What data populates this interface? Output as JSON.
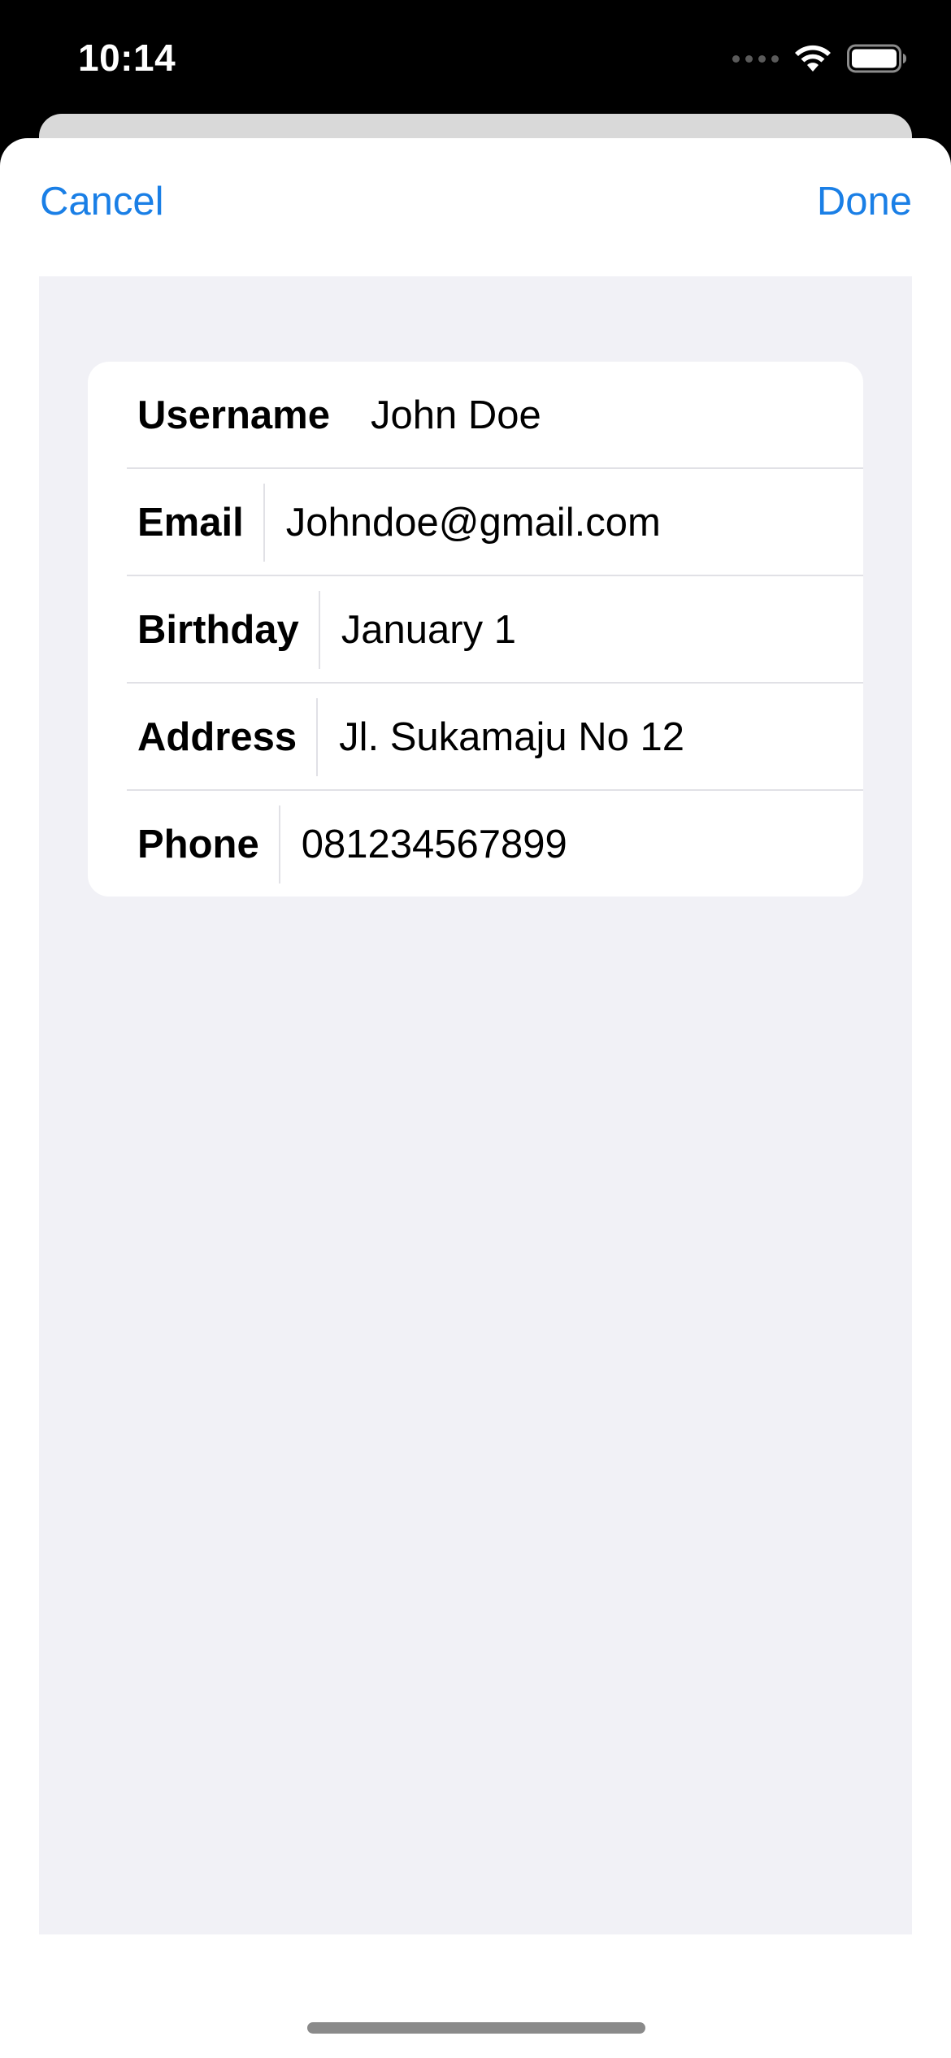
{
  "status_bar": {
    "time": "10:14",
    "icons": [
      "signal-icon",
      "wifi-icon",
      "battery-icon"
    ]
  },
  "nav": {
    "cancel_label": "Cancel",
    "done_label": "Done"
  },
  "form": {
    "fields": [
      {
        "label": "Username",
        "value": "John Doe"
      },
      {
        "label": "Email",
        "value": "Johndoe@gmail.com"
      },
      {
        "label": "Birthday",
        "value": "January 1"
      },
      {
        "label": "Address",
        "value": "Jl. Sukamaju No 12"
      },
      {
        "label": "Phone",
        "value": "081234567899"
      }
    ]
  },
  "colors": {
    "accent": "#1a7fe6",
    "background": "#f1f1f6",
    "card": "#ffffff"
  }
}
